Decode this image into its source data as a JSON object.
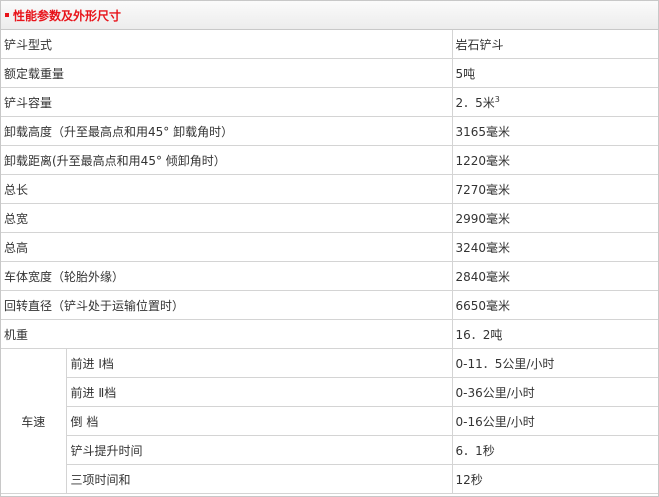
{
  "header": {
    "title": "性能参数及外形尺寸"
  },
  "rows": [
    {
      "label": "铲斗型式",
      "value": "岩石铲斗"
    },
    {
      "label": "额定载重量",
      "value": "5吨"
    },
    {
      "label": "铲斗容量",
      "value": "2．5米",
      "value_sup": "3"
    },
    {
      "label": "卸载高度（升至最高点和用45° 卸载角时）",
      "value": "3165毫米"
    },
    {
      "label": "卸载距离(升至最高点和用45° 倾卸角时）",
      "value": "1220毫米"
    },
    {
      "label": "总长",
      "value": "7270毫米"
    },
    {
      "label": "总宽",
      "value": "2990毫米"
    },
    {
      "label": "总高",
      "value": "3240毫米"
    },
    {
      "label": "车体宽度（轮胎外缘）",
      "value": "2840毫米"
    },
    {
      "label": "回转直径（铲斗处于运输位置时）",
      "value": "6650毫米"
    },
    {
      "label": "机重",
      "value": "16．2吨"
    }
  ],
  "speed_group": {
    "label": "车速",
    "rows": [
      {
        "label": "前进 Ⅰ档",
        "value": "0-11．5公里/小时"
      },
      {
        "label": "前进 Ⅱ档",
        "value": "0-36公里/小时"
      },
      {
        "label": "倒 档",
        "value": "0-16公里/小时"
      },
      {
        "label": "铲斗提升时间",
        "value": "6．1秒"
      },
      {
        "label": "三项时间和",
        "value": "12秒"
      }
    ]
  },
  "colors": {
    "title": "#e8141b",
    "border": "#d4d4d4",
    "header_bg": "#ececec",
    "text": "#333333"
  }
}
